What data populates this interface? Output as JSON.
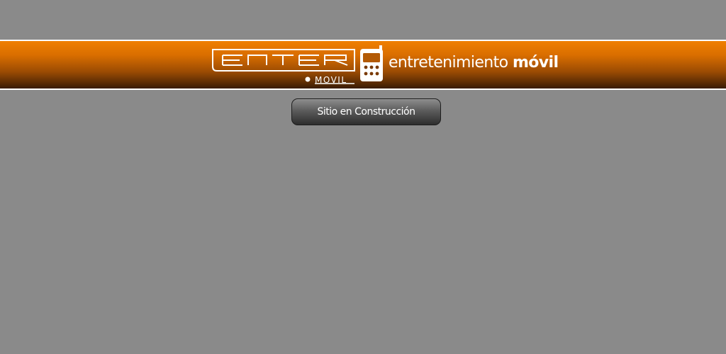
{
  "header": {
    "logo_word": "ENTER",
    "logo_sub": "MOVIL",
    "tagline_regular": "entretenimiento",
    "tagline_bold": "móvil",
    "logo_icon": "mobile-phone-icon"
  },
  "main": {
    "status_label": "Sitio en Construcción"
  },
  "colors": {
    "background": "#8a8a8a",
    "banner_top": "#f07f00",
    "banner_bottom": "#3a1c05",
    "button_top": "#8e8e8e",
    "button_bottom": "#2d2d2d"
  }
}
